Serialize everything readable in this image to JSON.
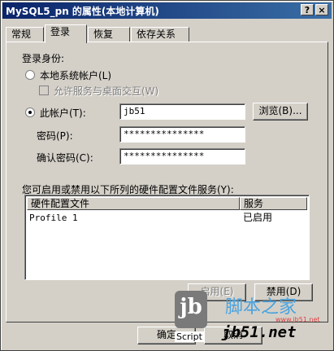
{
  "window": {
    "title": "MySQL5_pn 的属性(本地计算机)",
    "help_label": "?",
    "close_label": "×"
  },
  "tabs": [
    {
      "label": "常规"
    },
    {
      "label": "登录"
    },
    {
      "label": "恢复"
    },
    {
      "label": "依存关系"
    }
  ],
  "logon": {
    "heading": "登录身份:",
    "local_system_label": "本地系统帐户(L)",
    "allow_desktop_label": "允许服务与桌面交互(W)",
    "this_account_label": "此帐户(T):",
    "account_value": "jb51",
    "browse_label": "浏览(B)...",
    "password_label": "密码(P):",
    "password_value": "***************",
    "confirm_label": "确认密码(C):",
    "confirm_value": "***************"
  },
  "profiles": {
    "heading": "您可启用或禁用以下所列的硬件配置文件服务(Y):",
    "columns": [
      "硬件配置文件",
      "服务"
    ],
    "rows": [
      {
        "profile": "Profile 1",
        "service": "已启用"
      }
    ]
  },
  "buttons": {
    "enable_label": "启用(E)",
    "disable_label": "禁用(D)",
    "ok_label": "确定",
    "cancel_label": "取消"
  },
  "watermark": {
    "logo_text": "jb",
    "script_text": "Script",
    "site_cn": "脚本之家",
    "site_url": "jb51.net",
    "site_small": "www.jb51.net"
  },
  "colors": {
    "titlebar": "#0a246a",
    "face": "#d4d0c8",
    "watermark_text": "#4aa3df"
  }
}
